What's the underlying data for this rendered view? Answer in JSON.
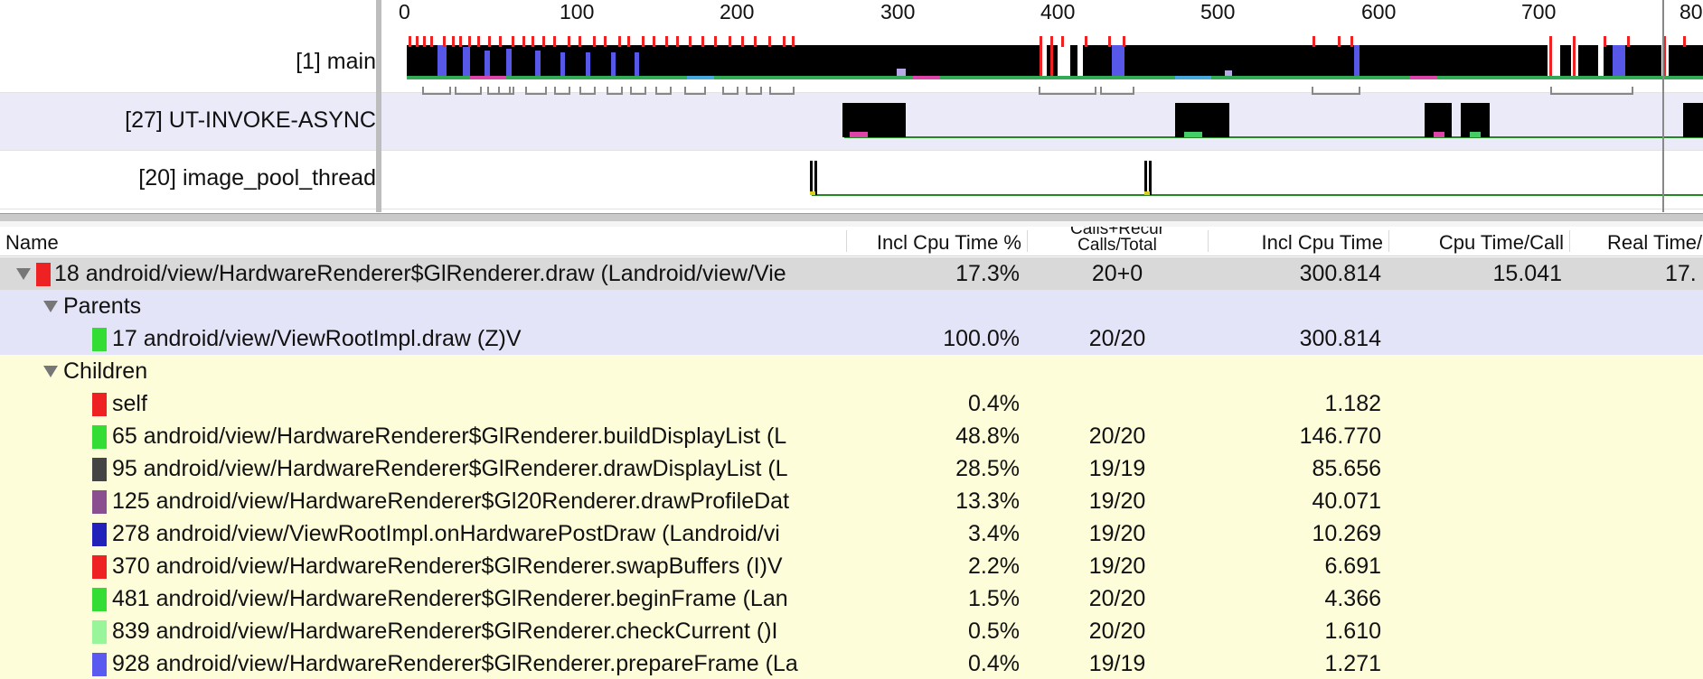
{
  "timeline": {
    "ticks": [
      "0",
      "100",
      "200",
      "300",
      "400",
      "500",
      "600",
      "700",
      "80"
    ],
    "threads": [
      {
        "label": "[1] main"
      },
      {
        "label": "[27] UT-INVOKE-ASYNC"
      },
      {
        "label": "[20] image_pool_thread"
      }
    ]
  },
  "profile": {
    "columns": {
      "name": "Name",
      "incl_pct": "Incl Cpu Time %",
      "calls_line1": "Calls+Recur",
      "calls_line2": "Calls/Total",
      "incl_time": "Incl Cpu Time",
      "cpu_per_call": "Cpu Time/Call",
      "real_time": "Real Time/"
    },
    "selected": {
      "name": "18 android/view/HardwareRenderer$GlRenderer.draw (Landroid/view/Vie",
      "incl_pct": "17.3%",
      "calls": "20+0",
      "incl_time": "300.814",
      "cpu_per_call": "15.041",
      "real_time": "17.",
      "color": "#ee2222"
    },
    "parents_label": "Parents",
    "parents": [
      {
        "name": "17 android/view/ViewRootImpl.draw (Z)V",
        "incl_pct": "100.0%",
        "calls": "20/20",
        "incl_time": "300.814",
        "color": "#33dd33"
      }
    ],
    "children_label": "Children",
    "children": [
      {
        "name": "self",
        "incl_pct": "0.4%",
        "calls": "",
        "incl_time": "1.182",
        "color": "#ee2222"
      },
      {
        "name": "65 android/view/HardwareRenderer$GlRenderer.buildDisplayList (L",
        "incl_pct": "48.8%",
        "calls": "20/20",
        "incl_time": "146.770",
        "color": "#33dd33"
      },
      {
        "name": "95 android/view/HardwareRenderer$GlRenderer.drawDisplayList (L",
        "incl_pct": "28.5%",
        "calls": "19/19",
        "incl_time": "85.656",
        "color": "#444444"
      },
      {
        "name": "125 android/view/HardwareRenderer$Gl20Renderer.drawProfileDat",
        "incl_pct": "13.3%",
        "calls": "19/20",
        "incl_time": "40.071",
        "color": "#8a4f8f"
      },
      {
        "name": "278 android/view/ViewRootImpl.onHardwarePostDraw (Landroid/vi",
        "incl_pct": "3.4%",
        "calls": "19/20",
        "incl_time": "10.269",
        "color": "#2222bb"
      },
      {
        "name": "370 android/view/HardwareRenderer$GlRenderer.swapBuffers (I)V",
        "incl_pct": "2.2%",
        "calls": "19/20",
        "incl_time": "6.691",
        "color": "#ee2222"
      },
      {
        "name": "481 android/view/HardwareRenderer$GlRenderer.beginFrame (Lan",
        "incl_pct": "1.5%",
        "calls": "20/20",
        "incl_time": "4.366",
        "color": "#33dd33"
      },
      {
        "name": "839 android/view/HardwareRenderer$GlRenderer.checkCurrent ()I",
        "incl_pct": "0.5%",
        "calls": "20/20",
        "incl_time": "1.610",
        "color": "#99f599"
      },
      {
        "name": "928 android/view/HardwareRenderer$GlRenderer.prepareFrame (La",
        "incl_pct": "0.4%",
        "calls": "19/19",
        "incl_time": "1.271",
        "color": "#5a5af0"
      }
    ]
  }
}
